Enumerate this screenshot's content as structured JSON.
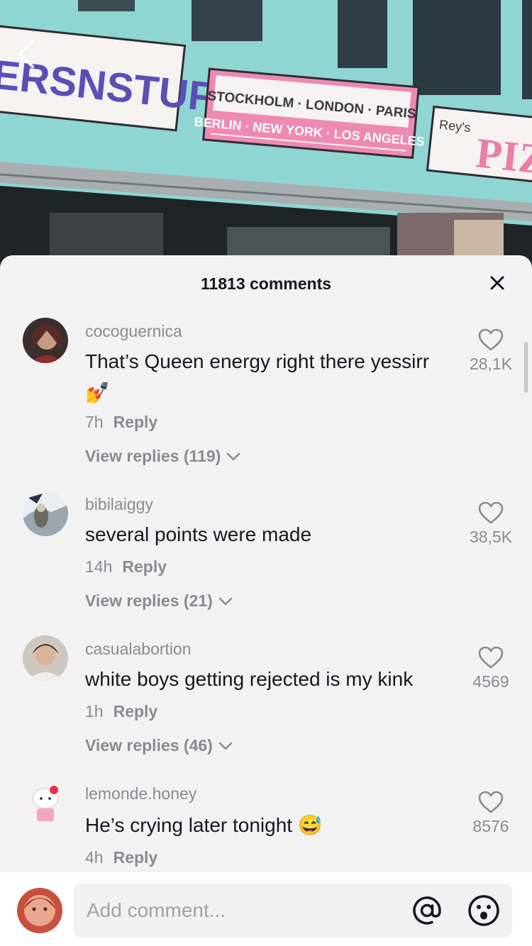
{
  "video": {
    "sign_left": "ERSNSTUFF",
    "sign_center_line1": "STOCKHOLM · LONDON · PARIS",
    "sign_center_line2": "BERLIN · NEW YORK · LOS ANGELES",
    "sign_right_small": "Rey's",
    "sign_right_big": "PIZ"
  },
  "sheet": {
    "title": "11813 comments"
  },
  "comments": [
    {
      "username": "cocoguernica",
      "text": "That’s Queen energy right there yessirr",
      "emoji": "💅",
      "time": "7h",
      "reply_label": "Reply",
      "view_replies": "View replies (119)",
      "likes": "28,1K"
    },
    {
      "username": "bibilaiggy",
      "text": "several points were made",
      "time": "14h",
      "reply_label": "Reply",
      "view_replies": "View replies (21)",
      "likes": "38,5K"
    },
    {
      "username": "casualabortion",
      "text": "white boys getting rejected is my kink",
      "time": "1h",
      "reply_label": "Reply",
      "view_replies": "View replies (46)",
      "likes": "4569"
    },
    {
      "username": "lemonde.honey",
      "text": "He’s crying later tonight",
      "emoji": "😅",
      "time": "4h",
      "reply_label": "Reply",
      "likes": "8576"
    }
  ],
  "composer": {
    "placeholder": "Add comment..."
  }
}
